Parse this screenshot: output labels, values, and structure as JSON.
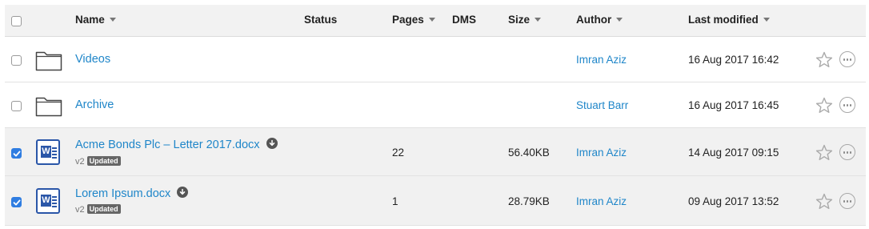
{
  "columns": {
    "name": "Name",
    "status": "Status",
    "pages": "Pages",
    "dms": "DMS",
    "size": "Size",
    "author": "Author",
    "last_modified": "Last modified"
  },
  "rows": [
    {
      "type": "folder",
      "name": "Videos",
      "pages": "",
      "size": "",
      "author": "Imran Aziz",
      "modified": "16 Aug 2017 16:42",
      "selected": false
    },
    {
      "type": "folder",
      "name": "Archive",
      "pages": "",
      "size": "",
      "author": "Stuart Barr",
      "modified": "16 Aug 2017 16:45",
      "selected": false
    },
    {
      "type": "word",
      "name": "Acme Bonds Plc – Letter 2017.docx",
      "version": "v2",
      "badge": "Updated",
      "pages": "22",
      "size": "56.40KB",
      "author": "Imran Aziz",
      "modified": "14 Aug 2017 09:15",
      "selected": true
    },
    {
      "type": "word",
      "name": "Lorem Ipsum.docx",
      "version": "v2",
      "badge": "Updated",
      "pages": "1",
      "size": "28.79KB",
      "author": "Imran Aziz",
      "modified": "09 Aug 2017 13:52",
      "selected": true
    }
  ],
  "icons": {
    "folder": "folder-icon",
    "word": "word-document-icon",
    "download": "download-icon",
    "star": "star-icon",
    "more": "more-options-icon"
  },
  "colors": {
    "link": "#1f86c9",
    "checked": "#2f7de1",
    "word": "#2a56a8"
  }
}
